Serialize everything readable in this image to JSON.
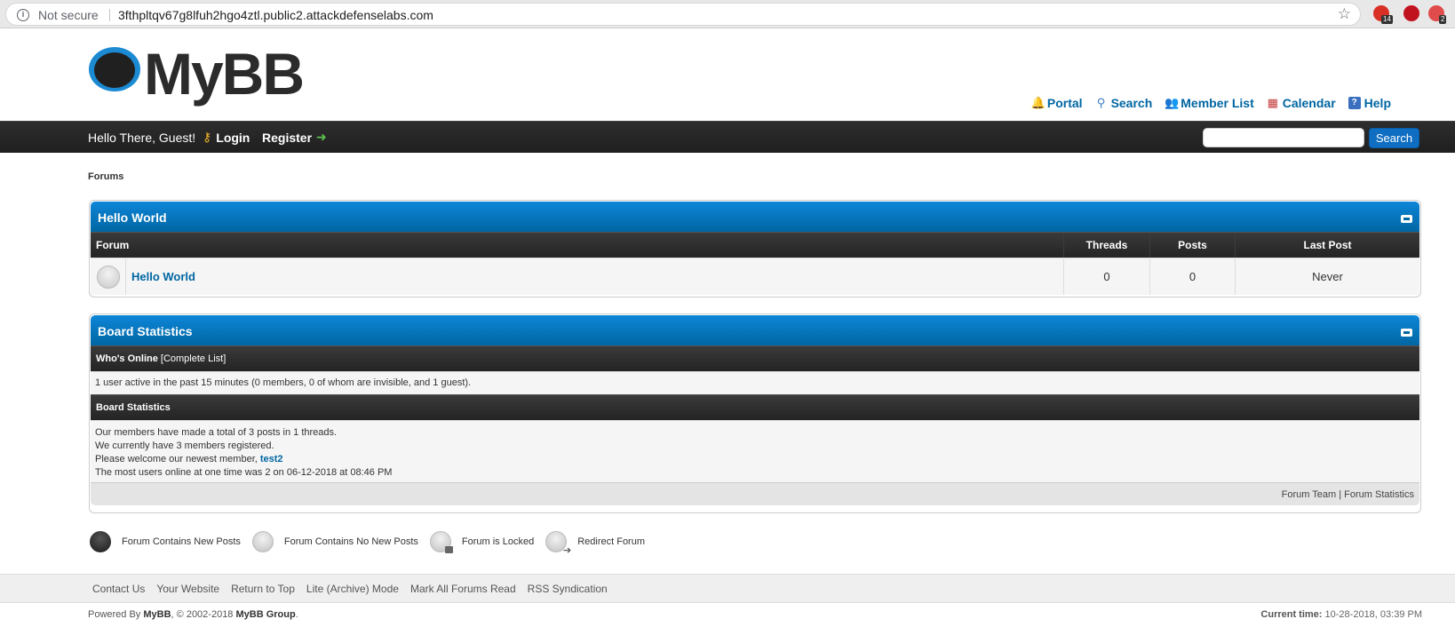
{
  "browser": {
    "security_label": "Not secure",
    "url": "3fthpltqv67g8lfuh2hgo4ztl.public2.attackdefenselabs.com",
    "extensions": [
      {
        "name": "todo-extension-icon",
        "badge": "14",
        "color": "#d93025"
      },
      {
        "name": "ublock-icon",
        "badge": "",
        "color": "#c1121f"
      },
      {
        "name": "extension-icon",
        "badge": "2",
        "color": "#e04b4b"
      }
    ]
  },
  "header": {
    "logo_text": "MyBB",
    "toplinks": [
      {
        "name": "portal",
        "label": "Portal",
        "icon": "bell-icon"
      },
      {
        "name": "search",
        "label": "Search",
        "icon": "magnifier-icon"
      },
      {
        "name": "member-list",
        "label": "Member List",
        "icon": "members-icon"
      },
      {
        "name": "calendar",
        "label": "Calendar",
        "icon": "calendar-icon"
      },
      {
        "name": "help",
        "label": "Help",
        "icon": "help-icon"
      }
    ]
  },
  "navbar": {
    "welcome": "Hello There, Guest!",
    "login_label": "Login",
    "register_label": "Register",
    "search_placeholder": "",
    "search_button": "Search"
  },
  "breadcrumb": "Forums",
  "forum_category": {
    "title": "Hello World",
    "columns": {
      "forum": "Forum",
      "threads": "Threads",
      "posts": "Posts",
      "last_post": "Last Post"
    },
    "forums": [
      {
        "name": "Hello World",
        "threads": "0",
        "posts": "0",
        "last_post": "Never"
      }
    ]
  },
  "board_stats": {
    "title": "Board Statistics",
    "whos_online_label": "Who's Online",
    "complete_list_label": "[Complete List]",
    "online_text": "1 user active in the past 15 minutes (0 members, 0 of whom are invisible, and 1 guest).",
    "stats_heading": "Board Statistics",
    "line1": "Our members have made a total of 3 posts in 1 threads.",
    "line2": "We currently have 3 members registered.",
    "line3_prefix": "Please welcome our newest member,",
    "newest_member": "test2",
    "line4": "The most users online at one time was 2 on 06-12-2018 at 08:46 PM",
    "footer_forum_team": "Forum Team",
    "footer_sep": "|",
    "footer_forum_stats": "Forum Statistics"
  },
  "legend": [
    {
      "name": "forum-new-posts",
      "label": "Forum Contains New Posts"
    },
    {
      "name": "forum-no-new-posts",
      "label": "Forum Contains No New Posts"
    },
    {
      "name": "forum-locked",
      "label": "Forum is Locked"
    },
    {
      "name": "redirect-forum",
      "label": "Redirect Forum"
    }
  ],
  "footer": {
    "links": [
      "Contact Us",
      "Your Website",
      "Return to Top",
      "Lite (Archive) Mode",
      "Mark All Forums Read",
      "RSS Syndication"
    ],
    "powered_by": "Powered By",
    "mybb": "MyBB",
    "copyright": ", © 2002-2018",
    "mybb_group": "MyBB Group",
    "period": ".",
    "current_time_label": "Current time:",
    "current_time": "10-28-2018, 03:39 PM"
  }
}
